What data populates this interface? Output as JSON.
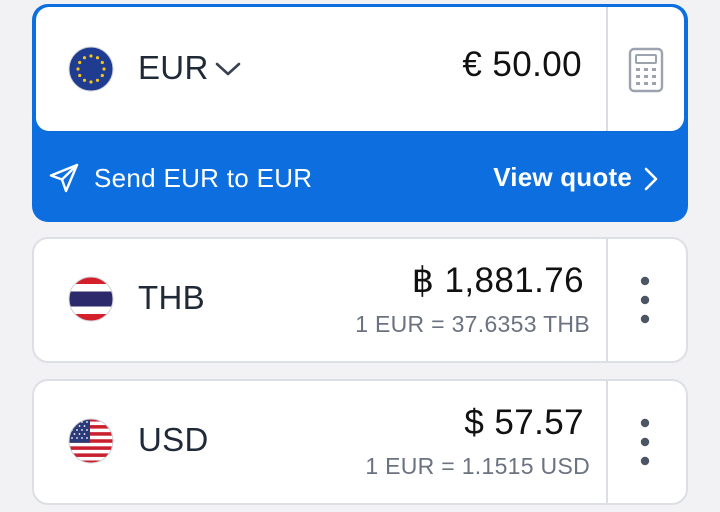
{
  "source": {
    "currency_code": "EUR",
    "amount": "€ 50.00",
    "send_text": "Send EUR to EUR",
    "view_quote_label": "View quote",
    "flag_icon": "eu-flag-icon"
  },
  "targets": [
    {
      "currency_code": "THB",
      "amount": "฿ 1,881.76",
      "rate": "1 EUR = 37.6353 THB",
      "flag_icon": "thailand-flag-icon"
    },
    {
      "currency_code": "USD",
      "amount": "$ 57.57",
      "rate": "1 EUR = 1.1515 USD",
      "flag_icon": "usa-flag-icon"
    }
  ],
  "icons": {
    "dropdown": "chevron-down-icon",
    "calculator": "calculator-icon",
    "send": "paper-plane-icon",
    "quote_arrow": "chevron-right-icon",
    "more": "more-vertical-icon"
  },
  "colors": {
    "accent": "#0d6fdf",
    "background": "#f2f2f4",
    "rate_text": "#6b7280"
  }
}
